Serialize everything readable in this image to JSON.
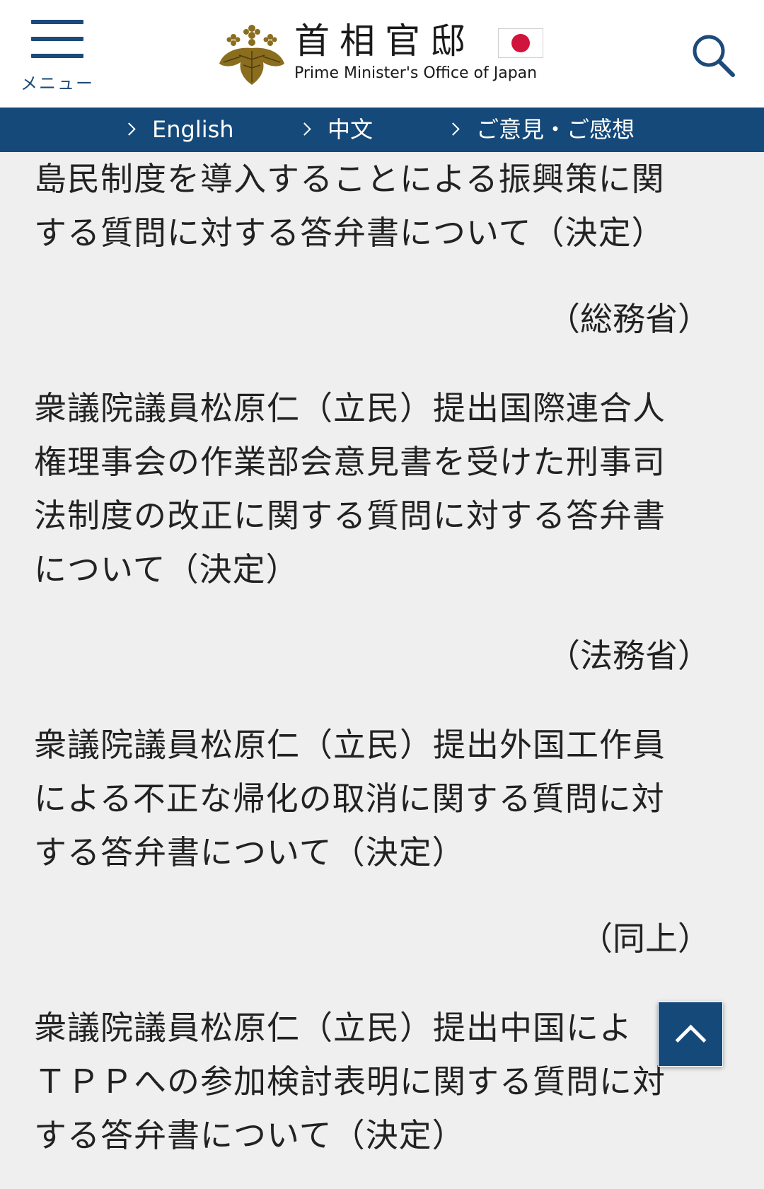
{
  "header": {
    "menu_label": "メニュー",
    "logo_jp": "首相官邸",
    "logo_en": "Prime Minister's Office of Japan",
    "brand_color": "#14497a"
  },
  "nav": {
    "items": [
      {
        "label": "English"
      },
      {
        "label": "中文"
      },
      {
        "label": "ご意見・ご感想"
      }
    ]
  },
  "entries": [
    {
      "lines": [
        "島民制度を導入することによる振興策に関",
        "する質問に対する答弁書について（決定）"
      ],
      "ministry": "（総務省）"
    },
    {
      "lines": [
        "衆議院議員松原仁（立民）提出国際連合人",
        "権理事会の作業部会意見書を受けた刑事司",
        "法制度の改正に関する質問に対する答弁書",
        "について（決定）"
      ],
      "ministry": "（法務省）"
    },
    {
      "lines": [
        "衆議院議員松原仁（立民）提出外国工作員",
        "による不正な帰化の取消に関する質問に対",
        "する答弁書について（決定）"
      ],
      "ministry": "（同上）"
    },
    {
      "lines": [
        "衆議院議員松原仁（立民）提出中国によ",
        "ＴＰＰへの参加検討表明に関する質問に対",
        "する答弁書について（決定）"
      ]
    }
  ]
}
